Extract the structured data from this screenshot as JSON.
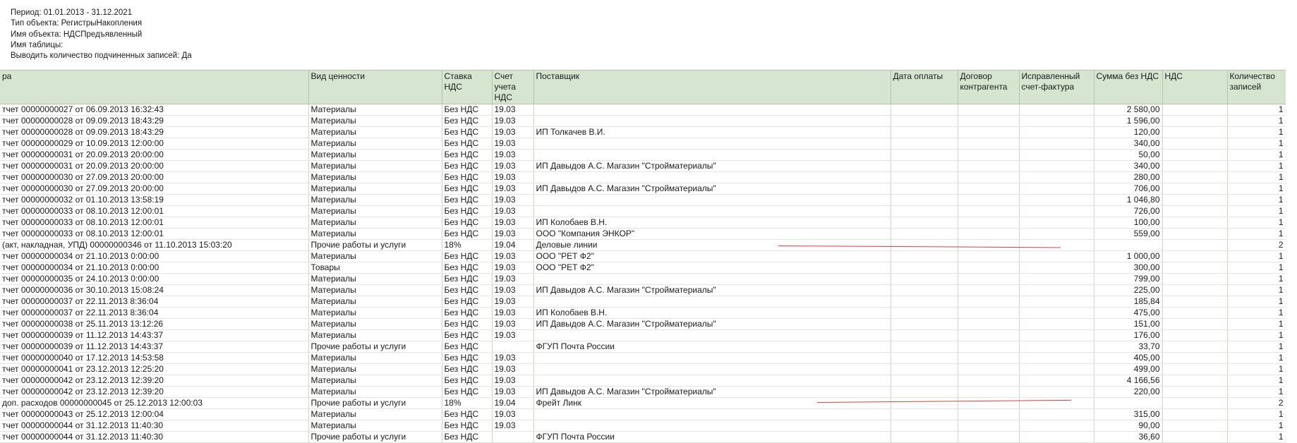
{
  "header": {
    "lines": [
      "Период: 01.01.2013 - 31.12.2021",
      "Тип объекта: РегистрыНакопления",
      "Имя объекта: НДСПредъявленный",
      "Имя таблицы:",
      "Выводить количество подчиненных записей: Да"
    ]
  },
  "table": {
    "columns": [
      "ра",
      "Вид ценности",
      "Ставка НДС",
      "Счет учета НДС",
      "Поставщик",
      "Дата оплаты",
      "Договор контрагента",
      "Исправленный счет-фактура",
      "Сумма без НДС",
      "НДС",
      "Количество записей"
    ],
    "rows": [
      [
        "тчет 00000000027 от 06.09.2013 16:32:43",
        "Материалы",
        "Без НДС",
        "19.03",
        "",
        "",
        "",
        "",
        "2 580,00",
        "",
        "1"
      ],
      [
        "тчет 00000000028 от 09.09.2013 18:43:29",
        "Материалы",
        "Без НДС",
        "19.03",
        "",
        "",
        "",
        "",
        "1 596,00",
        "",
        "1"
      ],
      [
        "тчет 00000000028 от 09.09.2013 18:43:29",
        "Материалы",
        "Без НДС",
        "19.03",
        "ИП Толкачев В.И.",
        "",
        "",
        "",
        "120,00",
        "",
        "1"
      ],
      [
        "тчет 00000000029 от 10.09.2013 12:00:00",
        "Материалы",
        "Без НДС",
        "19.03",
        "",
        "",
        "",
        "",
        "340,00",
        "",
        "1"
      ],
      [
        "тчет 00000000031 от 20.09.2013 20:00:00",
        "Материалы",
        "Без НДС",
        "19.03",
        "",
        "",
        "",
        "",
        "50,00",
        "",
        "1"
      ],
      [
        "тчет 00000000031 от 20.09.2013 20:00:00",
        "Материалы",
        "Без НДС",
        "19.03",
        "ИП Давыдов А.С. Магазин \"Стройматериалы\"",
        "",
        "",
        "",
        "340,00",
        "",
        "1"
      ],
      [
        "тчет 00000000030 от 27.09.2013 20:00:00",
        "Материалы",
        "Без НДС",
        "19.03",
        "",
        "",
        "",
        "",
        "280,00",
        "",
        "1"
      ],
      [
        "тчет 00000000030 от 27.09.2013 20:00:00",
        "Материалы",
        "Без НДС",
        "19.03",
        "ИП Давыдов А.С. Магазин \"Стройматериалы\"",
        "",
        "",
        "",
        "706,00",
        "",
        "1"
      ],
      [
        "тчет 00000000032 от 01.10.2013 13:58:19",
        "Материалы",
        "Без НДС",
        "19.03",
        "",
        "",
        "",
        "",
        "1 046,80",
        "",
        "1"
      ],
      [
        "тчет 00000000033 от 08.10.2013 12:00:01",
        "Материалы",
        "Без НДС",
        "19.03",
        "",
        "",
        "",
        "",
        "726,00",
        "",
        "1"
      ],
      [
        "тчет 00000000033 от 08.10.2013 12:00:01",
        "Материалы",
        "Без НДС",
        "19.03",
        "ИП Колобаев В.Н.",
        "",
        "",
        "",
        "100,00",
        "",
        "1"
      ],
      [
        "тчет 00000000033 от 08.10.2013 12:00:01",
        "Материалы",
        "Без НДС",
        "19.03",
        "ООО \"Компания ЭНКОР\"",
        "",
        "",
        "",
        "559,00",
        "",
        "1"
      ],
      [
        "(акт, накладная, УПД) 00000000346 от 11.10.2013 15:03:20",
        "Прочие работы и услуги",
        "18%",
        "19.04",
        "Деловые линии",
        "",
        "",
        "",
        "",
        "",
        "2"
      ],
      [
        "тчет 00000000034 от 21.10.2013 0:00:00",
        "Материалы",
        "Без НДС",
        "19.03",
        "ООО \"РЕТ Ф2\"",
        "",
        "",
        "",
        "1 000,00",
        "",
        "1"
      ],
      [
        "тчет 00000000034 от 21.10.2013 0:00:00",
        "Товары",
        "Без НДС",
        "19.03",
        "ООО \"РЕТ Ф2\"",
        "",
        "",
        "",
        "300,00",
        "",
        "1"
      ],
      [
        "тчет 00000000035 от 24.10.2013 0:00:00",
        "Материалы",
        "Без НДС",
        "19.03",
        "",
        "",
        "",
        "",
        "799,00",
        "",
        "1"
      ],
      [
        "тчет 00000000036 от 30.10.2013 15:08:24",
        "Материалы",
        "Без НДС",
        "19.03",
        "ИП Давыдов А.С. Магазин \"Стройматериалы\"",
        "",
        "",
        "",
        "225,00",
        "",
        "1"
      ],
      [
        "тчет 00000000037 от 22.11.2013 8:36:04",
        "Материалы",
        "Без НДС",
        "19.03",
        "",
        "",
        "",
        "",
        "185,84",
        "",
        "1"
      ],
      [
        "тчет 00000000037 от 22.11.2013 8:36:04",
        "Материалы",
        "Без НДС",
        "19.03",
        "ИП Колобаев В.Н.",
        "",
        "",
        "",
        "475,00",
        "",
        "1"
      ],
      [
        "тчет 00000000038 от 25.11.2013 13:12:26",
        "Материалы",
        "Без НДС",
        "19.03",
        "ИП Давыдов А.С. Магазин \"Стройматериалы\"",
        "",
        "",
        "",
        "151,00",
        "",
        "1"
      ],
      [
        "тчет 00000000039 от 11.12.2013 14:43:37",
        "Материалы",
        "Без НДС",
        "19.03",
        "",
        "",
        "",
        "",
        "176,00",
        "",
        "1"
      ],
      [
        "тчет 00000000039 от 11.12.2013 14:43:37",
        "Прочие работы и услуги",
        "Без НДС",
        "",
        "ФГУП Почта России",
        "",
        "",
        "",
        "33,70",
        "",
        "1"
      ],
      [
        "тчет 00000000040 от 17.12.2013 14:53:58",
        "Материалы",
        "Без НДС",
        "19.03",
        "",
        "",
        "",
        "",
        "405,00",
        "",
        "1"
      ],
      [
        "тчет 00000000041 от 23.12.2013 12:25:20",
        "Материалы",
        "Без НДС",
        "19.03",
        "",
        "",
        "",
        "",
        "499,00",
        "",
        "1"
      ],
      [
        "тчет 00000000042 от 23.12.2013 12:39:20",
        "Материалы",
        "Без НДС",
        "19.03",
        "",
        "",
        "",
        "",
        "4 166,56",
        "",
        "1"
      ],
      [
        "тчет 00000000042 от 23.12.2013 12:39:20",
        "Материалы",
        "Без НДС",
        "19.03",
        "ИП Давыдов А.С. Магазин \"Стройматериалы\"",
        "",
        "",
        "",
        "220,00",
        "",
        "1"
      ],
      [
        "доп. расходов 00000000045 от 25.12.2013 12:00:03",
        "Прочие работы и услуги",
        "18%",
        "19.04",
        "Фрейт Линк",
        "",
        "",
        "",
        "",
        "",
        "2"
      ],
      [
        "тчет 00000000043 от 25.12.2013 12:00:04",
        "Материалы",
        "Без НДС",
        "19.03",
        "",
        "",
        "",
        "",
        "315,00",
        "",
        "1"
      ],
      [
        "тчет 00000000044 от 31.12.2013 11:40:30",
        "Материалы",
        "Без НДС",
        "19.03",
        "",
        "",
        "",
        "",
        "90,00",
        "",
        "1"
      ],
      [
        "тчет 00000000044 от 31.12.2013 11:40:30",
        "Прочие работы и услуги",
        "Без НДС",
        "",
        "ФГУП Почта России",
        "",
        "",
        "",
        "36,60",
        "",
        "1"
      ]
    ]
  },
  "annotations": {
    "line_color": "#e53b3b"
  }
}
